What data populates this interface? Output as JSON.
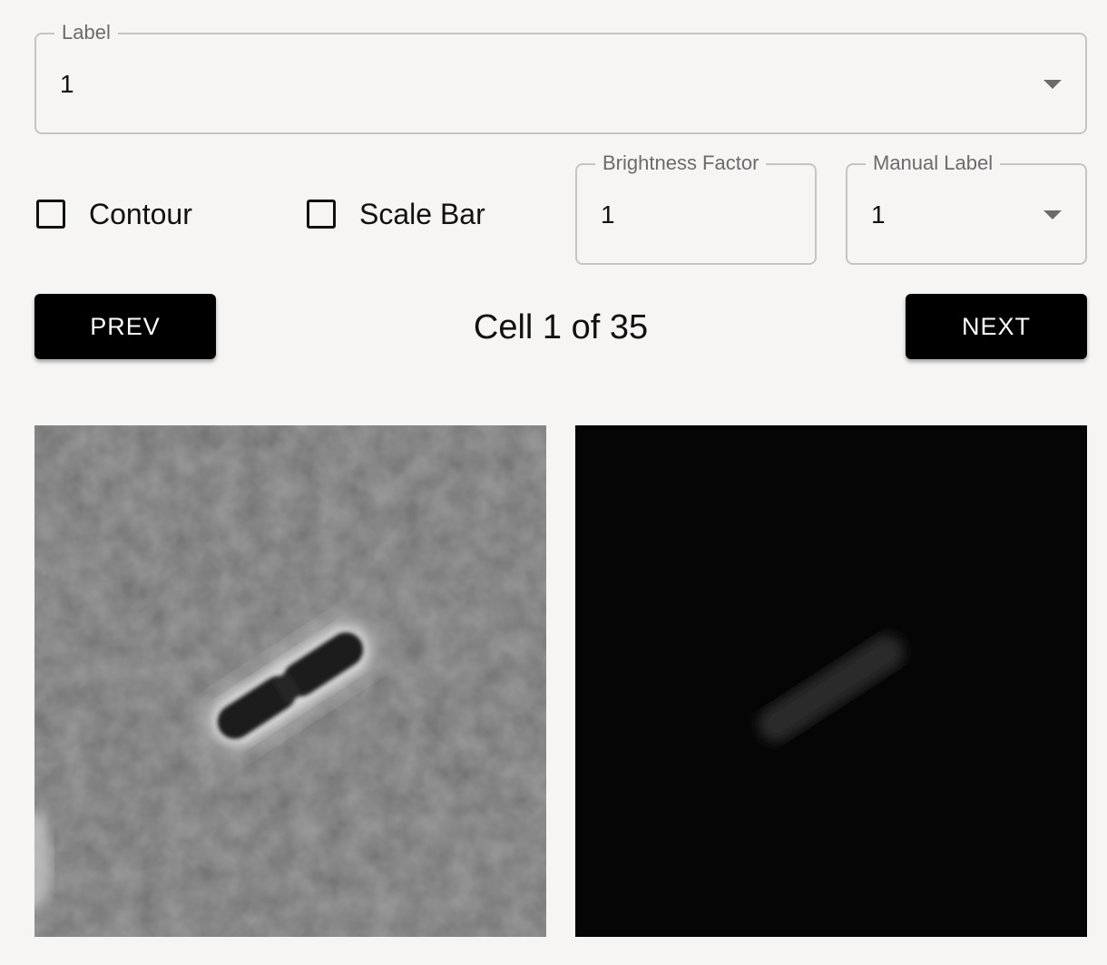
{
  "label_select": {
    "label": "Label",
    "value": "1",
    "icon": "chevron-down-icon"
  },
  "options": {
    "contour": {
      "label": "Contour",
      "checked": false
    },
    "scale_bar": {
      "label": "Scale Bar",
      "checked": false
    }
  },
  "brightness": {
    "label": "Brightness Factor",
    "value": "1"
  },
  "manual_label": {
    "label": "Manual Label",
    "value": "1",
    "icon": "chevron-down-icon"
  },
  "navigation": {
    "prev_label": "PREV",
    "next_label": "NEXT",
    "counter": "Cell 1 of 35"
  },
  "images": {
    "phase_contrast": {
      "background": "#7a7a7a"
    },
    "fluorescence": {
      "background": "#050505"
    }
  },
  "colors": {
    "page_background": "#f6f5f3",
    "button_background": "#000000",
    "border": "#c4c4c4"
  }
}
